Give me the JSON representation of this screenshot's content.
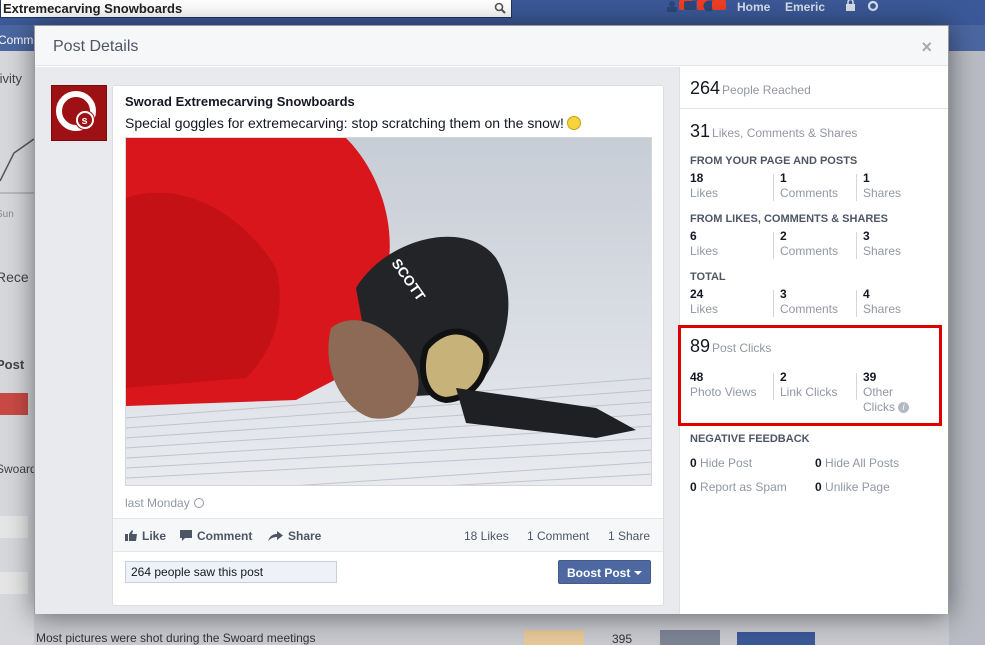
{
  "background": {
    "search_text": "Extremecarving Snowboards",
    "nav_home": "Home",
    "nav_user": "Emeric",
    "bluebar_text": "Comme",
    "left_texts": [
      "tivity",
      "Sun",
      "Rece",
      "Post",
      "Swoard"
    ],
    "bottom_text": "Most pictures were shot during the Swoard meetings",
    "bottom_number": "395"
  },
  "modal": {
    "title": "Post Details",
    "close_label": "×"
  },
  "post": {
    "page_name": "Sworad Extremecarving Snowboards",
    "text": "Special goggles for extremecarving: stop scratching them on the snow!",
    "time": "last Monday",
    "actions": {
      "like": "Like",
      "comment": "Comment",
      "share": "Share"
    },
    "stats": {
      "likes": "18 Likes",
      "comments": "1 Comment",
      "shares": "1 Share"
    },
    "people_saw": "264 people saw this post",
    "boost_label": "Boost Post"
  },
  "insights": {
    "reached": {
      "num": "264",
      "label": "People Reached"
    },
    "engagement": {
      "num": "31",
      "label": "Likes, Comments & Shares"
    },
    "from_page": {
      "title": "FROM YOUR PAGE AND POSTS",
      "cells": [
        {
          "num": "18",
          "label": "Likes"
        },
        {
          "num": "1",
          "label": "Comments"
        },
        {
          "num": "1",
          "label": "Shares"
        }
      ]
    },
    "from_likes": {
      "title": "FROM LIKES, COMMENTS & SHARES",
      "cells": [
        {
          "num": "6",
          "label": "Likes"
        },
        {
          "num": "2",
          "label": "Comments"
        },
        {
          "num": "3",
          "label": "Shares"
        }
      ]
    },
    "total": {
      "title": "TOTAL",
      "cells": [
        {
          "num": "24",
          "label": "Likes"
        },
        {
          "num": "3",
          "label": "Comments"
        },
        {
          "num": "4",
          "label": "Shares"
        }
      ]
    },
    "post_clicks": {
      "num": "89",
      "label": "Post Clicks",
      "cells": [
        {
          "num": "48",
          "label": "Photo Views"
        },
        {
          "num": "2",
          "label": "Link Clicks"
        },
        {
          "num": "39",
          "label": "Other",
          "label2": "Clicks"
        }
      ],
      "info_icon": "i"
    },
    "negative": {
      "title": "NEGATIVE FEEDBACK",
      "items": [
        {
          "num": "0",
          "label": "Hide Post"
        },
        {
          "num": "0",
          "label": "Hide All Posts"
        },
        {
          "num": "0",
          "label": "Report as Spam"
        },
        {
          "num": "0",
          "label": "Unlike Page"
        }
      ]
    }
  },
  "colors": {
    "accent": "#4e69a2",
    "highlight": "#e00000",
    "brand": "#9d1014"
  }
}
